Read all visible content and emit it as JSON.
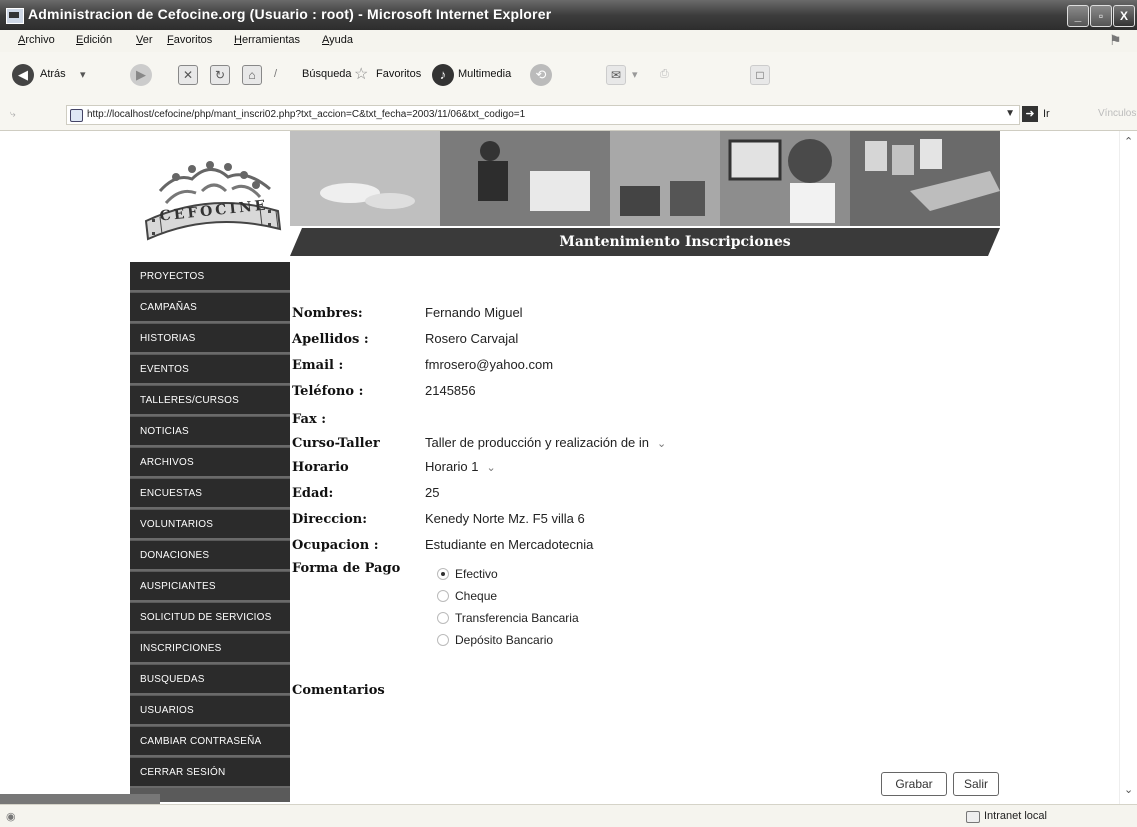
{
  "window": {
    "title": "Administracion de Cefocine.org (Usuario : root) - Microsoft Internet Explorer",
    "buttons": {
      "minimize": "_",
      "maximize": "▫",
      "close": "X"
    }
  },
  "menu": [
    "Archivo",
    "Edición",
    "Ver",
    "Favoritos",
    "Herramientas",
    "Ayuda"
  ],
  "toolbar": {
    "back": "Atrás",
    "search": "Búsqueda",
    "favorites": "Favoritos",
    "multimedia": "Multimedia"
  },
  "address": {
    "url": "http://localhost/cefocine/php/mant_inscri02.php?txt_accion=C&txt_fecha=2003/11/06&txt_codigo=1",
    "go_label": "Ir",
    "links_label": "Vínculos"
  },
  "logo": {
    "text": "CEFOCINE"
  },
  "page_title": "Mantenimiento Inscripciones",
  "nav": [
    "PROYECTOS",
    "CAMPAÑAS",
    "HISTORIAS",
    "EVENTOS",
    "TALLERES/CURSOS",
    "NOTICIAS",
    "ARCHIVOS",
    "ENCUESTAS",
    "VOLUNTARIOS",
    "DONACIONES",
    "AUSPICIANTES",
    "SOLICITUD DE SERVICIOS",
    "INSCRIPCIONES",
    "BUSQUEDAS",
    "USUARIOS",
    "CAMBIAR CONTRASEÑA",
    "CERRAR SESIÓN"
  ],
  "form": {
    "nombres": {
      "label": "Nombres:",
      "value": "Fernando Miguel"
    },
    "apellidos": {
      "label": "Apellidos :",
      "value": "Rosero Carvajal"
    },
    "email": {
      "label": "Email :",
      "value": "fmrosero@yahoo.com"
    },
    "telefono": {
      "label": "Teléfono :",
      "value": "2145856"
    },
    "fax": {
      "label": "Fax :",
      "value": ""
    },
    "curso": {
      "label": "Curso-Taller",
      "value": "Taller de producción y realización de in"
    },
    "horario": {
      "label": "Horario",
      "value": "Horario 1"
    },
    "edad": {
      "label": "Edad:",
      "value": "25"
    },
    "direccion": {
      "label": "Direccion:",
      "value": "Kenedy Norte Mz. F5 villa 6"
    },
    "ocupacion": {
      "label": "Ocupacion :",
      "value": "Estudiante en Mercadotecnia"
    },
    "forma_pago": {
      "label": "Forma de Pago",
      "options": [
        "Efectivo",
        "Cheque",
        "Transferencia Bancaria",
        "Depósito Bancario"
      ],
      "selected": "Efectivo"
    },
    "comentarios": {
      "label": "Comentarios"
    }
  },
  "buttons": {
    "grabar": "Grabar",
    "salir": "Salir"
  },
  "status": {
    "zone": "Intranet local"
  }
}
